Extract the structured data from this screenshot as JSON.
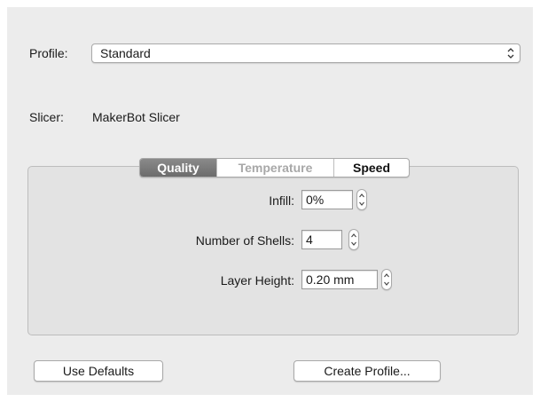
{
  "profile": {
    "label": "Profile:",
    "value": "Standard"
  },
  "slicer": {
    "label": "Slicer:",
    "value": "MakerBot Slicer"
  },
  "tabs": [
    {
      "label": "Quality",
      "state": "selected"
    },
    {
      "label": "Temperature",
      "state": "disabled"
    },
    {
      "label": "Speed",
      "state": "normal"
    }
  ],
  "quality": {
    "infill": {
      "label": "Infill:",
      "value": "0%"
    },
    "shells": {
      "label": "Number of Shells:",
      "value": "4"
    },
    "layer_height": {
      "label": "Layer Height:",
      "value": "0.20 mm"
    }
  },
  "buttons": {
    "use_defaults": "Use Defaults",
    "create_profile": "Create Profile..."
  },
  "icons": {
    "popup_arrows": "up-down-arrows-icon",
    "stepper": "stepper-arrows-icon"
  }
}
